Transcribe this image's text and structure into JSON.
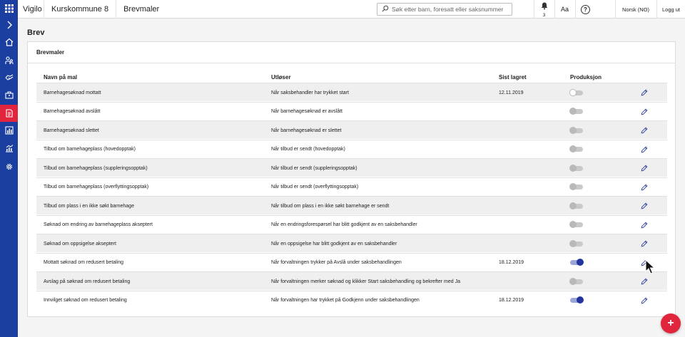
{
  "colors": {
    "rail": "#1a3fa0",
    "accent": "#e0253d",
    "toggle_on": "#23349e"
  },
  "topbar": {
    "app_name": "Vigilo",
    "breadcrumb": [
      "Kurskommune 8",
      "Brevmaler"
    ],
    "search_placeholder": "Søk etter barn, foresatt eller saksnummer",
    "notification_count": "3",
    "text_size_label": "Aa",
    "help_label": "?",
    "language": "Norsk (NO)",
    "logout": "Logg ut"
  },
  "rail": {
    "icons": [
      "grid-icon",
      "chevron-right-icon",
      "home-icon",
      "children-icon",
      "handshake-icon",
      "briefcase-icon",
      "document-icon",
      "chart-icon",
      "stats-icon",
      "gear-icon"
    ],
    "active_icon": "document-icon"
  },
  "page": {
    "title": "Brev",
    "card_title": "Brevmaler"
  },
  "table": {
    "headers": [
      "Navn på mal",
      "Utløser",
      "Sist lagret",
      "Produksjon"
    ],
    "rows": [
      {
        "name": "Barnehagesøknad mottatt",
        "trigger": "Når saksbehandler har trykket start",
        "saved": "12.11.2019",
        "production": false
      },
      {
        "name": "Barnehagesøknad avslått",
        "trigger": "Når barnehagesøknad er avslått",
        "saved": "",
        "production": false
      },
      {
        "name": "Barnehagesøknad slettet",
        "trigger": "Når barnehagesøknad er slettet",
        "saved": "",
        "production": false
      },
      {
        "name": "Tilbud om barnehageplass (hovedopptak)",
        "trigger": "Når tilbud er sendt (hovedopptak)",
        "saved": "",
        "production": false
      },
      {
        "name": "Tilbud om barnehageplass (suppleringsopptak)",
        "trigger": "Når tilbud er sendt (suppleringsopptak)",
        "saved": "",
        "production": false
      },
      {
        "name": "Tilbud om barnehageplass (overflyttingsopptak)",
        "trigger": "Når tilbud er sendt (overflyttingsopptak)",
        "saved": "",
        "production": false
      },
      {
        "name": "Tilbud om plass i en ikke søkt barnehage",
        "trigger": "Når tilbud om plass i en ikke søkt barnehage er sendt",
        "saved": "",
        "production": false
      },
      {
        "name": "Søknad om endring av barnehageplass akseptert",
        "trigger": "Når en endringsforespørsel har blitt godkjent av en saksbehandler",
        "saved": "",
        "production": false
      },
      {
        "name": "Søknad om oppsigelse akseptert",
        "trigger": "Når en oppsigelse har blitt godkjent av en saksbehandler",
        "saved": "",
        "production": false
      },
      {
        "name": "Mottatt søknad om redusert betaling",
        "trigger": "Når forvaltningen trykker på Avslå under saksbehandlingen",
        "saved": "18.12.2019",
        "production": true
      },
      {
        "name": "Avslag på søknad om redusert betaling",
        "trigger": "Når forvaltningen merker søknad og klikker Start saksbehandling og bekrefter med Ja",
        "saved": "",
        "production": false
      },
      {
        "name": "Innvilget søknad om redusert betaling",
        "trigger": "Når forvaltningen har trykket på Godkjenn under saksbehandlingen",
        "saved": "18.12.2019",
        "production": true
      }
    ]
  },
  "fab_label": "+"
}
